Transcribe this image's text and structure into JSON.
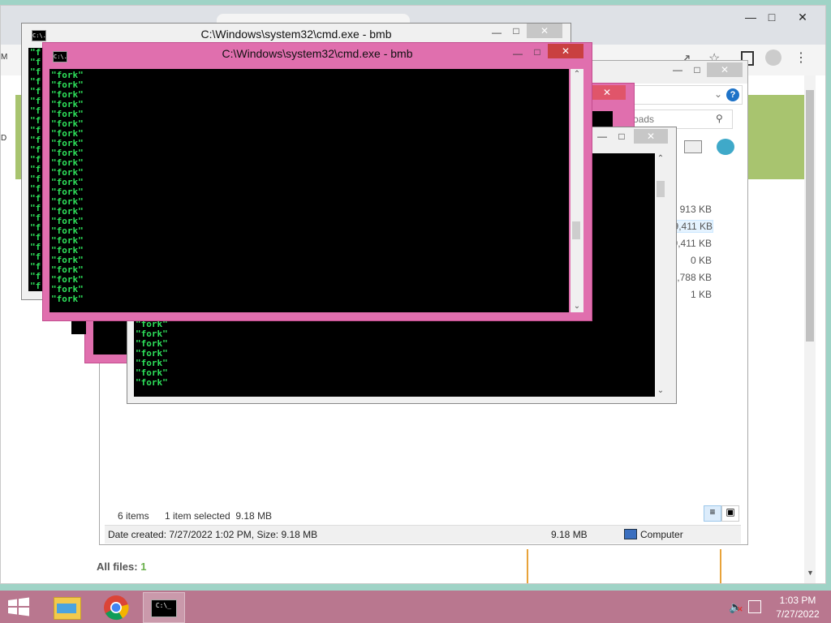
{
  "chrome": {
    "all_files_label": "All files:",
    "all_files_count": "1",
    "icons": [
      "share-icon",
      "star-icon",
      "sidebar-icon",
      "profile-icon",
      "menu-icon"
    ]
  },
  "explorer": {
    "search_placeholder": "oads",
    "sizes": [
      "913 KB",
      "9,411 KB",
      "9,411 KB",
      "0 KB",
      "0,788 KB",
      "1 KB"
    ],
    "status_items": "6 items",
    "status_selected": "1 item selected  9.18 MB",
    "details_left": "Date created: 7/27/2022 1:02 PM, Size: 9.18 MB",
    "details_size": "9.18 MB",
    "details_location": "Computer"
  },
  "cmd": {
    "title_back": "C:\\Windows\\system32\\cmd.exe - bmb",
    "title_front": "C:\\Windows\\system32\\cmd.exe - bmb",
    "fork_line": "\"fork\"",
    "fork_partial": "\"f",
    "icon_label": "C:\\."
  },
  "taskbar": {
    "time": "1:03 PM",
    "date": "7/27/2022",
    "colors": {
      "accent": "#b9778f",
      "console_text": "#2ee05a",
      "pink_frame": "#e06fae"
    }
  }
}
